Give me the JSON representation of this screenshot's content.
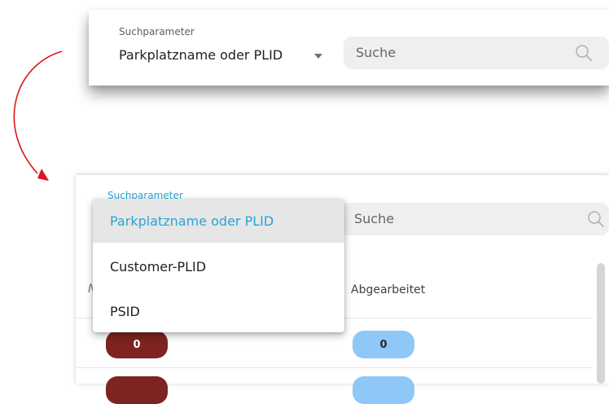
{
  "top_panel": {
    "field_label": "Suchparameter",
    "selected_value": "Parkplatzname oder PLID",
    "search_placeholder": "Suche"
  },
  "bottom_panel": {
    "field_label": "Suchparameter",
    "search_placeholder": "Suche",
    "dropdown": {
      "options": [
        {
          "label": "Parkplatzname oder PLID",
          "selected": true
        },
        {
          "label": "Customer-PLID",
          "selected": false
        },
        {
          "label": "PSID",
          "selected": false
        }
      ]
    },
    "table": {
      "partial_header": "N",
      "header_processed": "Abgearbeitet",
      "rows": [
        {
          "open": "0",
          "processed": "0"
        },
        {
          "open": "",
          "processed": ""
        }
      ]
    }
  },
  "colors": {
    "accent": "#22a7d6",
    "arrow": "#e0141a",
    "pill_red": "#7d2320",
    "pill_blue": "#8fc7f7"
  }
}
